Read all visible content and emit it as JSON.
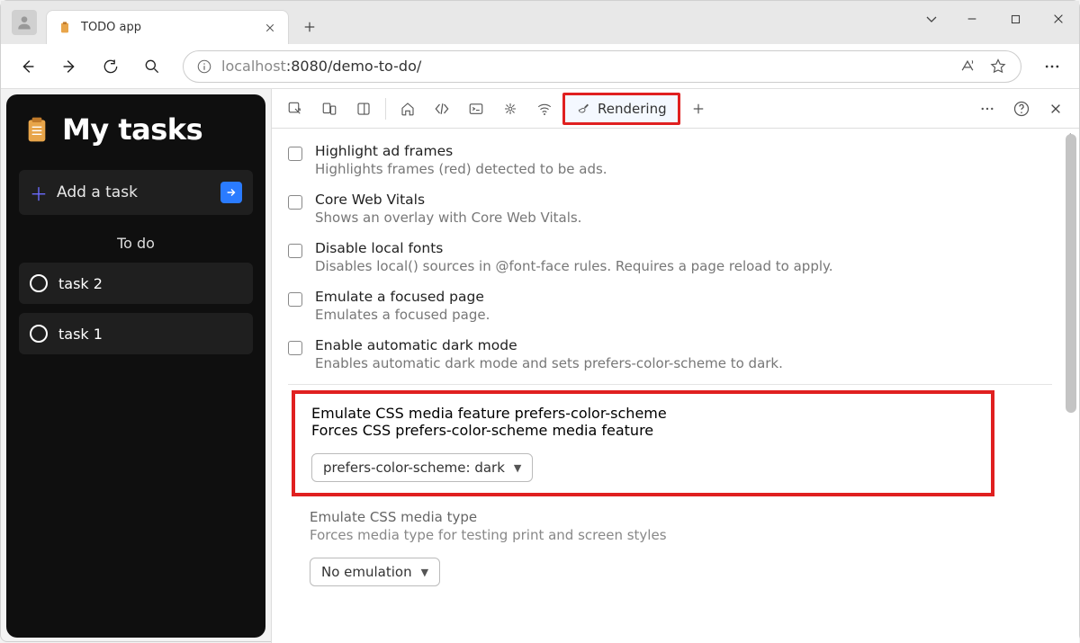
{
  "window": {
    "tab_title": "TODO app"
  },
  "address": {
    "host": "localhost",
    "rest": ":8080/demo-to-do/"
  },
  "app": {
    "title": "My tasks",
    "add_label": "Add a task",
    "section": "To do",
    "tasks": [
      "task 2",
      "task 1"
    ]
  },
  "devtools": {
    "rendering_tab": "Rendering",
    "options": [
      {
        "title": "Highlight ad frames",
        "desc": "Highlights frames (red) detected to be ads."
      },
      {
        "title": "Core Web Vitals",
        "desc": "Shows an overlay with Core Web Vitals."
      },
      {
        "title": "Disable local fonts",
        "desc": "Disables local() sources in @font-face rules. Requires a page reload to apply."
      },
      {
        "title": "Emulate a focused page",
        "desc": "Emulates a focused page."
      },
      {
        "title": "Enable automatic dark mode",
        "desc": "Enables automatic dark mode and sets prefers-color-scheme to dark."
      }
    ],
    "emulate_color": {
      "title": "Emulate CSS media feature prefers-color-scheme",
      "desc": "Forces CSS prefers-color-scheme media feature",
      "value": "prefers-color-scheme: dark"
    },
    "emulate_media": {
      "title": "Emulate CSS media type",
      "desc": "Forces media type for testing print and screen styles",
      "value": "No emulation"
    }
  }
}
